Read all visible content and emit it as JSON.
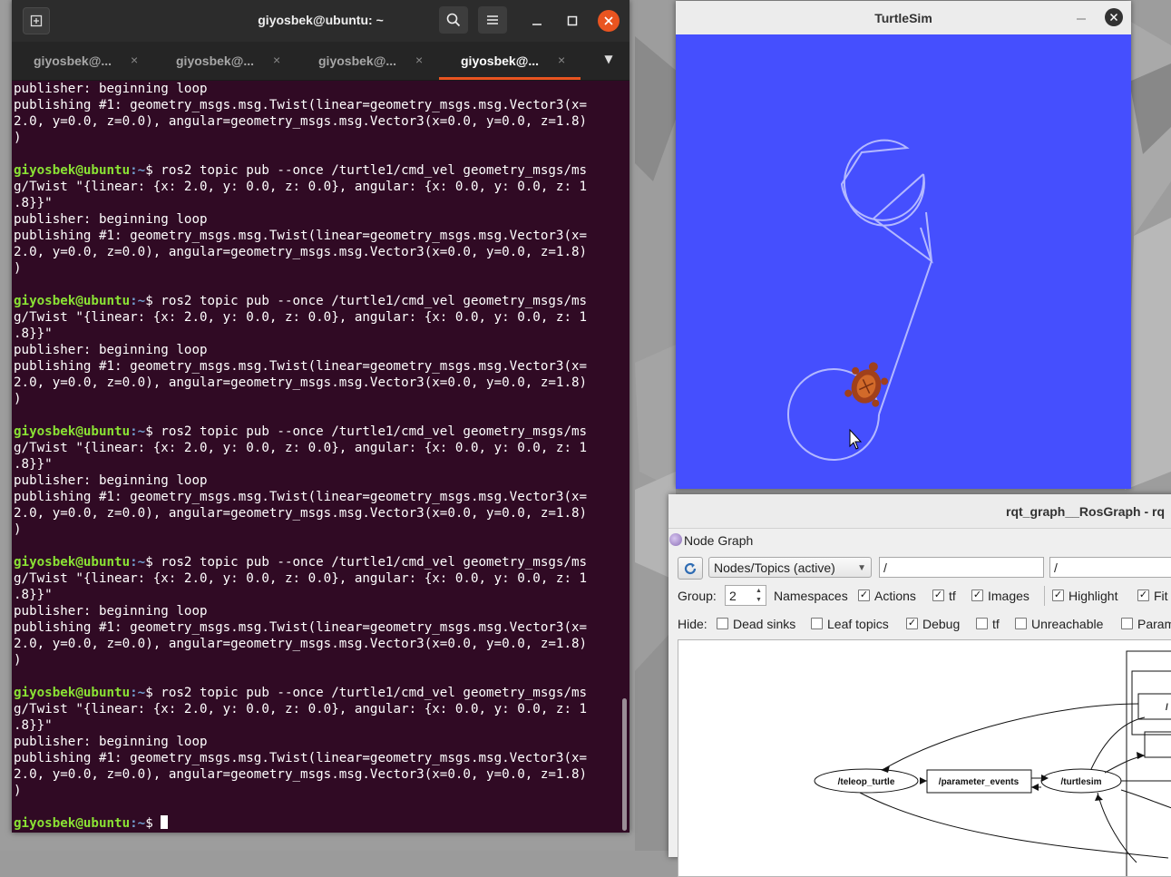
{
  "terminal": {
    "title": "giyosbek@ubuntu: ~",
    "tabs": [
      {
        "label": "giyosbek@...",
        "close": "×"
      },
      {
        "label": "giyosbek@...",
        "close": "×"
      },
      {
        "label": "giyosbek@...",
        "close": "×"
      },
      {
        "label": "giyosbek@...",
        "close": "×"
      }
    ],
    "lines": [
      {
        "text": "publisher: beginning loop"
      },
      {
        "text": "publishing #1: geometry_msgs.msg.Twist(linear=geometry_msgs.msg.Vector3(x="
      },
      {
        "text": "2.0, y=0.0, z=0.0), angular=geometry_msgs.msg.Vector3(x=0.0, y=0.0, z=1.8)"
      },
      {
        "text": ")"
      },
      {
        "text": ""
      },
      {
        "user": "giyosbek@ubuntu",
        "path": ":~",
        "text": "$ ros2 topic pub --once /turtle1/cmd_vel geometry_msgs/ms"
      },
      {
        "text": "g/Twist \"{linear: {x: 2.0, y: 0.0, z: 0.0}, angular: {x: 0.0, y: 0.0, z: 1"
      },
      {
        "text": ".8}}\""
      },
      {
        "text": "publisher: beginning loop"
      },
      {
        "text": "publishing #1: geometry_msgs.msg.Twist(linear=geometry_msgs.msg.Vector3(x="
      },
      {
        "text": "2.0, y=0.0, z=0.0), angular=geometry_msgs.msg.Vector3(x=0.0, y=0.0, z=1.8)"
      },
      {
        "text": ")"
      },
      {
        "text": ""
      },
      {
        "user": "giyosbek@ubuntu",
        "path": ":~",
        "text": "$ ros2 topic pub --once /turtle1/cmd_vel geometry_msgs/ms"
      },
      {
        "text": "g/Twist \"{linear: {x: 2.0, y: 0.0, z: 0.0}, angular: {x: 0.0, y: 0.0, z: 1"
      },
      {
        "text": ".8}}\""
      },
      {
        "text": "publisher: beginning loop"
      },
      {
        "text": "publishing #1: geometry_msgs.msg.Twist(linear=geometry_msgs.msg.Vector3(x="
      },
      {
        "text": "2.0, y=0.0, z=0.0), angular=geometry_msgs.msg.Vector3(x=0.0, y=0.0, z=1.8)"
      },
      {
        "text": ")"
      },
      {
        "text": ""
      },
      {
        "user": "giyosbek@ubuntu",
        "path": ":~",
        "text": "$ ros2 topic pub --once /turtle1/cmd_vel geometry_msgs/ms"
      },
      {
        "text": "g/Twist \"{linear: {x: 2.0, y: 0.0, z: 0.0}, angular: {x: 0.0, y: 0.0, z: 1"
      },
      {
        "text": ".8}}\""
      },
      {
        "text": "publisher: beginning loop"
      },
      {
        "text": "publishing #1: geometry_msgs.msg.Twist(linear=geometry_msgs.msg.Vector3(x="
      },
      {
        "text": "2.0, y=0.0, z=0.0), angular=geometry_msgs.msg.Vector3(x=0.0, y=0.0, z=1.8)"
      },
      {
        "text": ")"
      },
      {
        "text": ""
      },
      {
        "user": "giyosbek@ubuntu",
        "path": ":~",
        "text": "$ ros2 topic pub --once /turtle1/cmd_vel geometry_msgs/ms"
      },
      {
        "text": "g/Twist \"{linear: {x: 2.0, y: 0.0, z: 0.0}, angular: {x: 0.0, y: 0.0, z: 1"
      },
      {
        "text": ".8}}\""
      },
      {
        "text": "publisher: beginning loop"
      },
      {
        "text": "publishing #1: geometry_msgs.msg.Twist(linear=geometry_msgs.msg.Vector3(x="
      },
      {
        "text": "2.0, y=0.0, z=0.0), angular=geometry_msgs.msg.Vector3(x=0.0, y=0.0, z=1.8)"
      },
      {
        "text": ")"
      },
      {
        "text": ""
      },
      {
        "user": "giyosbek@ubuntu",
        "path": ":~",
        "text": "$ ros2 topic pub --once /turtle1/cmd_vel geometry_msgs/ms"
      },
      {
        "text": "g/Twist \"{linear: {x: 2.0, y: 0.0, z: 0.0}, angular: {x: 0.0, y: 0.0, z: 1"
      },
      {
        "text": ".8}}\""
      },
      {
        "text": "publisher: beginning loop"
      },
      {
        "text": "publishing #1: geometry_msgs.msg.Twist(linear=geometry_msgs.msg.Vector3(x="
      },
      {
        "text": "2.0, y=0.0, z=0.0), angular=geometry_msgs.msg.Vector3(x=0.0, y=0.0, z=1.8)"
      },
      {
        "text": ")"
      },
      {
        "text": ""
      },
      {
        "user": "giyosbek@ubuntu",
        "path": ":~",
        "text": "$ "
      }
    ],
    "colors": {
      "background": "#300a24",
      "prompt_user": "#8ae234",
      "prompt_path": "#729fcf",
      "accent": "#e95420"
    }
  },
  "turtlesim": {
    "title": "TurtleSim",
    "background_color": "#454ffe"
  },
  "rqt": {
    "title": "rqt_graph__RosGraph - rq",
    "panel_title": "Node Graph",
    "mode": "Nodes/Topics (active)",
    "filter1": "/",
    "filter2": "/",
    "group_label": "Group:",
    "group_value": "2",
    "options": {
      "namespaces": {
        "label": "Namespaces",
        "checked": true
      },
      "actions": {
        "label": "Actions",
        "checked": true
      },
      "tf": {
        "label": "tf",
        "checked": true
      },
      "images": {
        "label": "Images",
        "checked": true
      },
      "highlight": {
        "label": "Highlight",
        "checked": true
      },
      "fit": {
        "label": "Fit",
        "checked": true
      }
    },
    "hide_label": "Hide:",
    "hide": {
      "dead_sinks": {
        "label": "Dead sinks",
        "checked": false
      },
      "leaf_topics": {
        "label": "Leaf topics",
        "checked": false
      },
      "debug": {
        "label": "Debug",
        "checked": true
      },
      "tf": {
        "label": "tf",
        "checked": false
      },
      "unreachable": {
        "label": "Unreachable",
        "checked": false
      },
      "params": {
        "label": "Param",
        "checked": false
      }
    },
    "graph_nodes": {
      "teleop": "/teleop_turtle",
      "parameter_events": "/parameter_events",
      "turtlesim": "/turtlesim",
      "partial": "/"
    }
  }
}
